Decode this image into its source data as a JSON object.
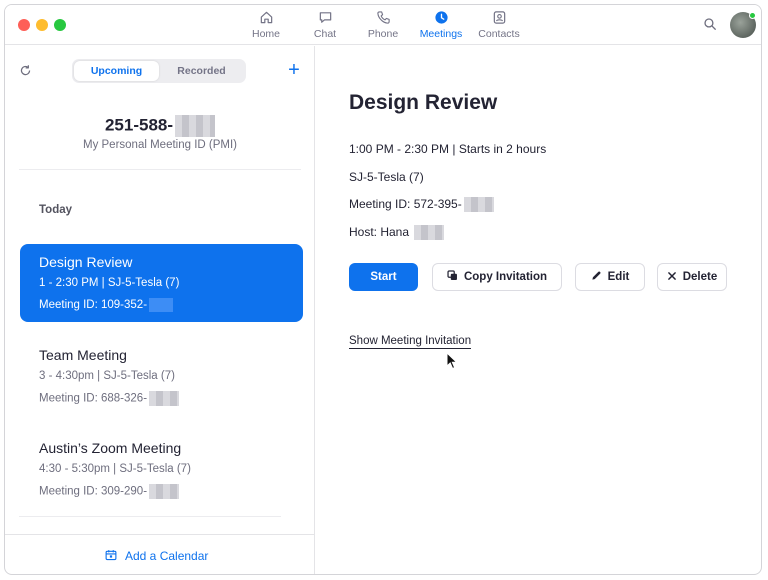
{
  "nav": {
    "tabs": [
      {
        "label": "Home",
        "icon": "home-icon"
      },
      {
        "label": "Chat",
        "icon": "chat-icon"
      },
      {
        "label": "Phone",
        "icon": "phone-icon"
      },
      {
        "label": "Meetings",
        "icon": "clock-icon",
        "active": true
      },
      {
        "label": "Contacts",
        "icon": "contacts-icon"
      }
    ]
  },
  "colors": {
    "accent": "#0e72ed",
    "close": "#fe5f57",
    "minimize": "#febc2e",
    "maximize": "#28c840",
    "presence": "#28c840"
  },
  "meetings_panel": {
    "tab_upcoming": "Upcoming",
    "tab_recorded": "Recorded",
    "add_symbol": "+",
    "pmi": {
      "number": "251-588-",
      "label": "My Personal Meeting ID (PMI)"
    },
    "day_header": "Today",
    "items": [
      {
        "title": "Design Review",
        "time": "1 - 2:30 PM  |  SJ-5-Tesla (7)",
        "meeting_id": "Meeting ID: 109-352-",
        "selected": true
      },
      {
        "title": "Team Meeting",
        "time": "3 - 4:30pm  |  SJ-5-Tesla (7)",
        "meeting_id": "Meeting ID: 688-326-"
      },
      {
        "title": "Austin’s Zoom Meeting",
        "time": "4:30 - 5:30pm  |  SJ-5-Tesla (7)",
        "meeting_id": "Meeting ID: 309-290-"
      }
    ],
    "add_calendar": "Add a Calendar"
  },
  "detail": {
    "title": "Design Review",
    "time_line": "1:00 PM - 2:30 PM  |  Starts in 2 hours",
    "room": "SJ-5-Tesla (7)",
    "meeting_id": "Meeting ID: 572-395-",
    "host": "Host: Hana",
    "buttons": {
      "start": "Start",
      "copy": "Copy Invitation",
      "edit": "Edit",
      "delete": "Delete"
    },
    "show_invitation": "Show Meeting Invitation"
  }
}
